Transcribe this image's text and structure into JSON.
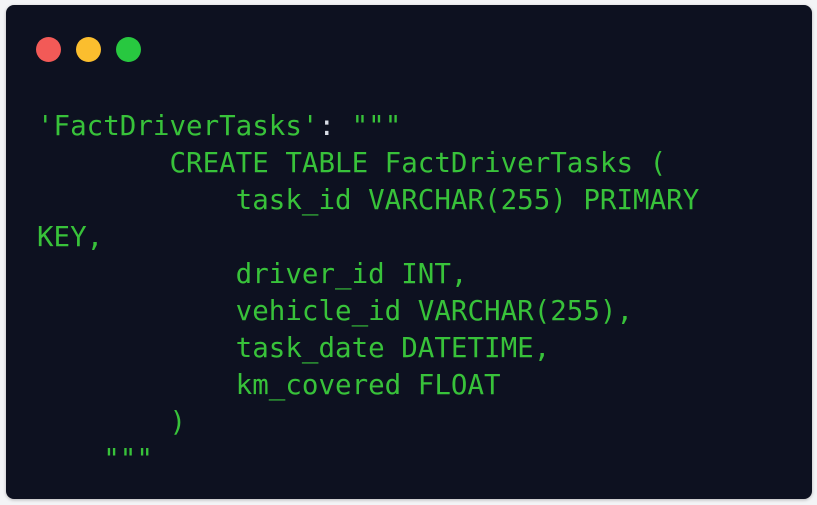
{
  "window": {
    "background": "#0d1120",
    "controls": [
      {
        "name": "close",
        "color": "#f25a57"
      },
      {
        "name": "minimize",
        "color": "#fbbe2e"
      },
      {
        "name": "maximize",
        "color": "#28c840"
      }
    ]
  },
  "code": {
    "text_color": "#38c23a",
    "punct_color": "#d8dde6",
    "key": "'FactDriverTasks'",
    "colon": ":",
    "open_quotes": " \"\"\"",
    "lines": [
      "        CREATE TABLE FactDriverTasks (",
      "            task_id VARCHAR(255) PRIMARY",
      "KEY,",
      "            driver_id INT,",
      "            vehicle_id VARCHAR(255),",
      "            task_date DATETIME,",
      "            km_covered FLOAT",
      "        )",
      "    \"\"\""
    ]
  }
}
